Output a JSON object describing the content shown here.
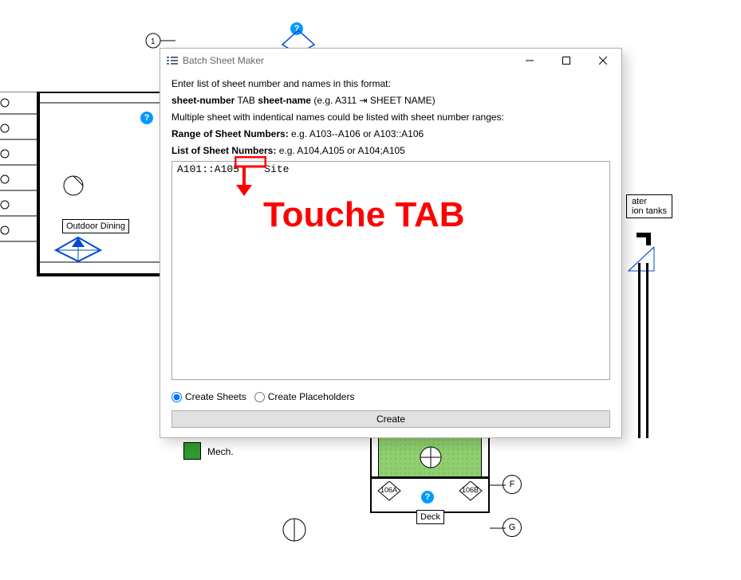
{
  "dialog": {
    "title": "Batch Sheet Maker",
    "intro": "Enter list of sheet number and names in this format:",
    "format_lead": "sheet-number",
    "format_mid": "TAB",
    "format_tail": "sheet-name",
    "format_example": "(e.g. A311 ⇥ SHEET NAME)",
    "multi_line": "Multiple sheet with indentical names could be listed with sheet number ranges:",
    "range_label": "Range of Sheet Numbers:",
    "range_example": "e.g. A103--A106 or A103::A106",
    "list_label": "List of Sheet Numbers:",
    "list_example": "e.g. A104,A105 or A104;A105",
    "input_text": "A101::A105    Site",
    "opt_sheets": "Create Sheets",
    "opt_placeholders": "Create Placeholders",
    "radio_selected": "sheets",
    "create_label": "Create"
  },
  "annotation": {
    "caption": "Touche TAB"
  },
  "canvas": {
    "outdoor_label": "Outdoor Dining",
    "mech_label": "Mech.",
    "deck_label": "Deck",
    "tank_label_line1": "ater",
    "tank_label_line2": "ion tanks",
    "tag_left": "106A",
    "tag_right": "106B",
    "grid_f": "F",
    "grid_g": "G"
  }
}
